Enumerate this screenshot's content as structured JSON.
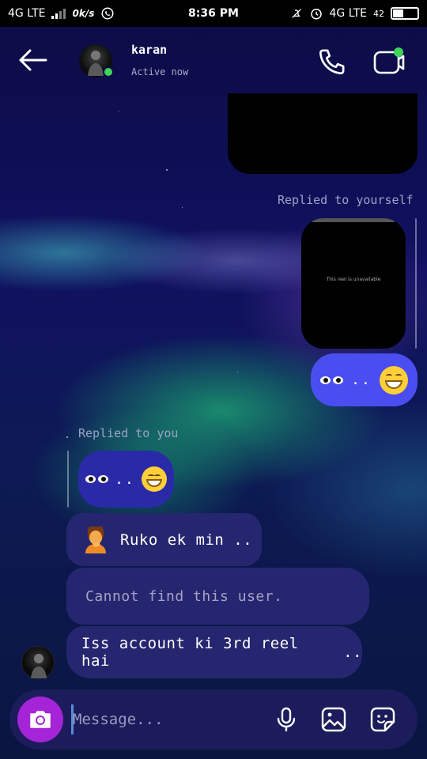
{
  "status_bar": {
    "network_left": "4G LTE",
    "speed": "0k/s",
    "time": "8:36 PM",
    "network_right": "4G LTE",
    "battery_text": "42",
    "battery_level": 0.42
  },
  "header": {
    "name": "karan",
    "status": "Active now"
  },
  "messages": {
    "replied_to_yourself": "Replied to yourself",
    "reel_caption": "This reel is unavailable",
    "replied_to_you": "Replied to you",
    "msg_ruko": "Ruko ek min ..",
    "msg_cannot_find": "Cannot find this user.",
    "msg_iss_account": "Iss account ki 3rd reel hai",
    "msg_iss_account_dots": ".."
  },
  "composer": {
    "placeholder": "Message..."
  },
  "colors": {
    "my_bubble": "#4a4ef0",
    "their_bubble": "#262670",
    "camera_button": "#a524d8",
    "online": "#3ed55a"
  },
  "icons": {
    "back": "arrow-left-icon",
    "call": "phone-icon",
    "video": "video-call-icon",
    "camera": "camera-icon",
    "mic": "microphone-icon",
    "gallery": "image-icon",
    "sticker": "sticker-icon",
    "whatsapp": "whatsapp-icon"
  }
}
